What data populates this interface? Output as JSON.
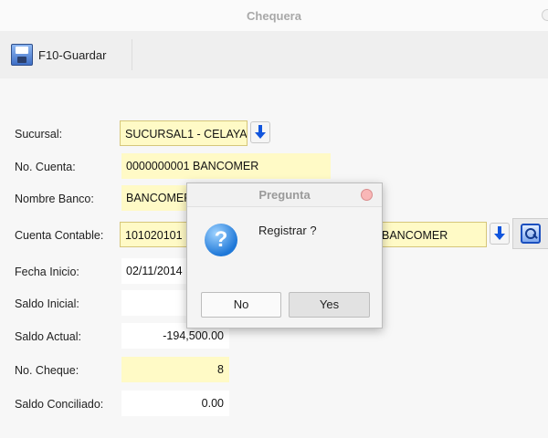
{
  "window": {
    "title": "Chequera"
  },
  "toolbar": {
    "save_label": "F10-Guardar",
    "save_icon": "save-icon"
  },
  "form": {
    "sucursal": {
      "label": "Sucursal:",
      "value": "SUCURSAL1 - CELAYA"
    },
    "no_cuenta": {
      "label": "No. Cuenta:",
      "value": "0000000001 BANCOMER"
    },
    "nombre_banco": {
      "label": "Nombre Banco:",
      "value": "BANCOMER"
    },
    "cuenta_contable": {
      "label": "Cuenta Contable:",
      "value": "101020101",
      "description": "BANCOMER"
    },
    "fecha_inicio": {
      "label": "Fecha Inicio:",
      "value": "02/11/2014"
    },
    "saldo_inicial": {
      "label": "Saldo Inicial:",
      "value": ""
    },
    "saldo_actual": {
      "label": "Saldo Actual:",
      "value": "-194,500.00"
    },
    "no_cheque": {
      "label": "No. Cheque:",
      "value": "8"
    },
    "saldo_conciliado": {
      "label": "Saldo Conciliado:",
      "value": "0.00"
    }
  },
  "dialog": {
    "title": "Pregunta",
    "icon": "question-icon",
    "message": "Registrar ?",
    "no_label": "No",
    "yes_label": "Yes"
  },
  "colors": {
    "field_yellow": "#fffac6",
    "accent_blue": "#1155dd"
  }
}
